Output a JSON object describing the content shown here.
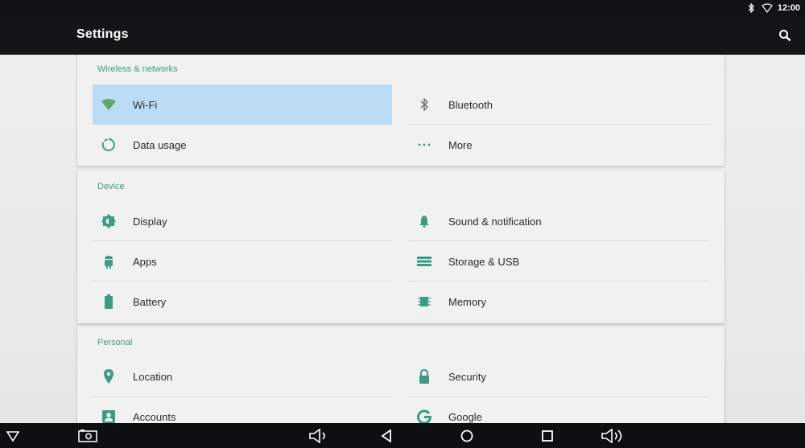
{
  "status_bar": {
    "time": "12:00",
    "icons": [
      "bluetooth-icon",
      "wifi-icon"
    ]
  },
  "action_bar": {
    "title": "Settings",
    "search_icon": "search-icon"
  },
  "colors": {
    "accent": "#3e9b83",
    "selected": "#bcdcf6",
    "icon": "#6a6a6a",
    "bar": "#141517"
  },
  "sections": [
    {
      "header": "Wireless & networks",
      "items": [
        {
          "label": "Wi-Fi",
          "icon": "wifi-icon",
          "selected": true
        },
        {
          "label": "Bluetooth",
          "icon": "bluetooth-icon"
        },
        {
          "label": "Data usage",
          "icon": "data-usage-icon"
        },
        {
          "label": "More",
          "icon": "more-icon"
        }
      ]
    },
    {
      "header": "Device",
      "items": [
        {
          "label": "Display",
          "icon": "brightness-icon"
        },
        {
          "label": "Sound & notification",
          "icon": "bell-icon"
        },
        {
          "label": "Apps",
          "icon": "android-icon"
        },
        {
          "label": "Storage & USB",
          "icon": "storage-icon"
        },
        {
          "label": "Battery",
          "icon": "battery-icon"
        },
        {
          "label": "Memory",
          "icon": "memory-icon"
        }
      ]
    },
    {
      "header": "Personal",
      "items": [
        {
          "label": "Location",
          "icon": "location-pin-icon"
        },
        {
          "label": "Security",
          "icon": "lock-icon"
        },
        {
          "label": "Accounts",
          "icon": "account-icon"
        },
        {
          "label": "Google",
          "icon": "google-icon"
        }
      ]
    }
  ],
  "nav_bar": {
    "buttons": [
      "dropdown-icon",
      "screenshot-icon",
      "volume-down-icon",
      "back-icon",
      "home-icon",
      "recents-icon",
      "volume-up-icon"
    ]
  }
}
